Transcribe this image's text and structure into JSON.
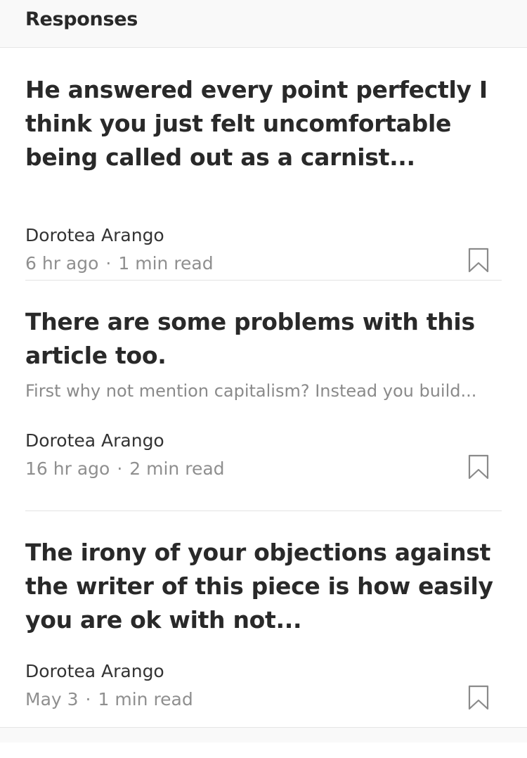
{
  "header": {
    "title": "Responses"
  },
  "responses": [
    {
      "title": "He answered every point perfectly I think you just felt uncomfortable being called out as a carnist...",
      "snippet": "",
      "author": "Dorotea Arango",
      "time": "6 hr ago",
      "read_time": "1 min read",
      "separator": "·",
      "bookmark_icon": "bookmark-icon"
    },
    {
      "title": "There are some problems with this article too.",
      "snippet": "First why not mention capitalism? Instead you build...",
      "author": "Dorotea Arango",
      "time": "16 hr ago",
      "read_time": "2 min read",
      "separator": "·",
      "bookmark_icon": "bookmark-icon"
    },
    {
      "title": "The irony of your objections against the writer of this piece is how easily you are ok with not...",
      "snippet": "",
      "author": "Dorotea Arango",
      "time": "May 3",
      "read_time": "1 min read",
      "separator": "·",
      "bookmark_icon": "bookmark-icon"
    }
  ]
}
